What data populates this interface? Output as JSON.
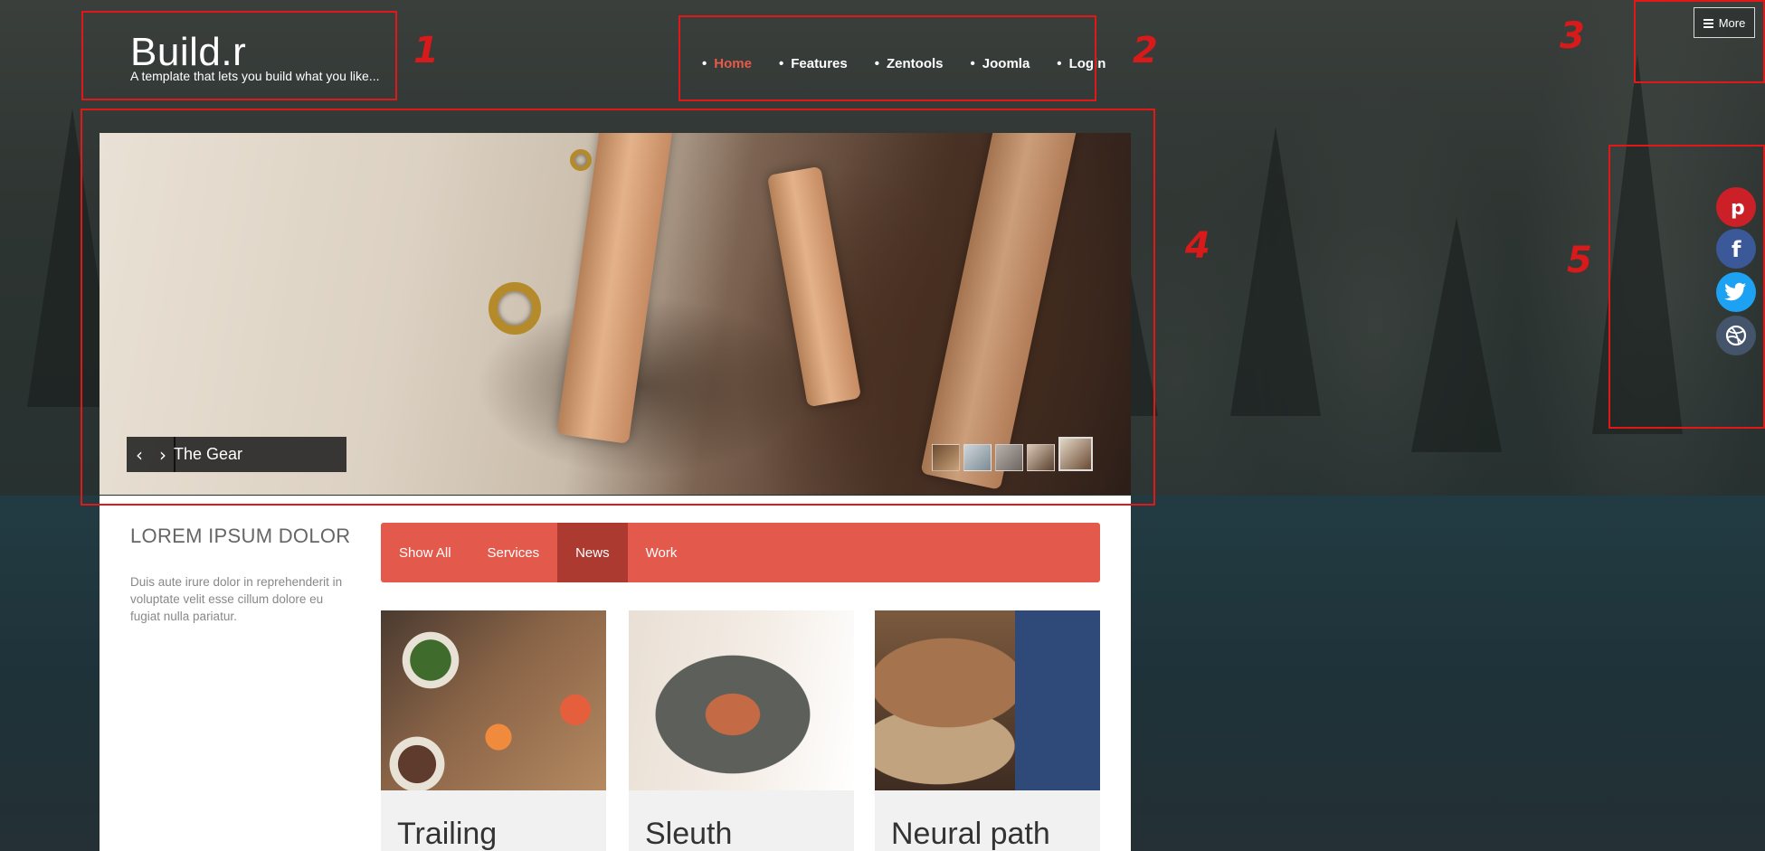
{
  "header": {
    "logo_title": "Build.r",
    "logo_tagline": "A template that lets you build what you like..."
  },
  "nav": {
    "items": [
      {
        "label": "Home",
        "active": true
      },
      {
        "label": "Features"
      },
      {
        "label": "Zentools"
      },
      {
        "label": "Joomla"
      },
      {
        "label": "Login"
      }
    ]
  },
  "more_button": {
    "label": "More",
    "icon": "hamburger-icon"
  },
  "slider": {
    "caption": "The Gear",
    "prev_icon": "chevron-left-icon",
    "next_icon": "chevron-right-icon",
    "thumbnail_count": 5
  },
  "sidebar": {
    "title": "LOREM IPSUM DOLOR",
    "text": "Duis aute irure dolor in reprehenderit in voluptate velit esse cillum dolore eu fugiat nulla pariatur."
  },
  "filter_tabs": [
    {
      "label": "Show All"
    },
    {
      "label": "Services"
    },
    {
      "label": "News",
      "active": true
    },
    {
      "label": "Work"
    }
  ],
  "cards": [
    {
      "title": "Trailing"
    },
    {
      "title": "Sleuth"
    },
    {
      "title": "Neural path"
    }
  ],
  "social": [
    {
      "icon": "pinterest-icon",
      "color": "#cb2027"
    },
    {
      "icon": "facebook-icon",
      "color": "#3b5998"
    },
    {
      "icon": "twitter-icon",
      "color": "#1da1f2"
    },
    {
      "icon": "dribbble-icon",
      "color": "#44546a"
    }
  ],
  "annotations": [
    "1",
    "2",
    "3",
    "4",
    "5"
  ],
  "colors": {
    "accent": "#e35a4d",
    "accent_active": "#ad3a31",
    "annotation": "#e01818"
  }
}
